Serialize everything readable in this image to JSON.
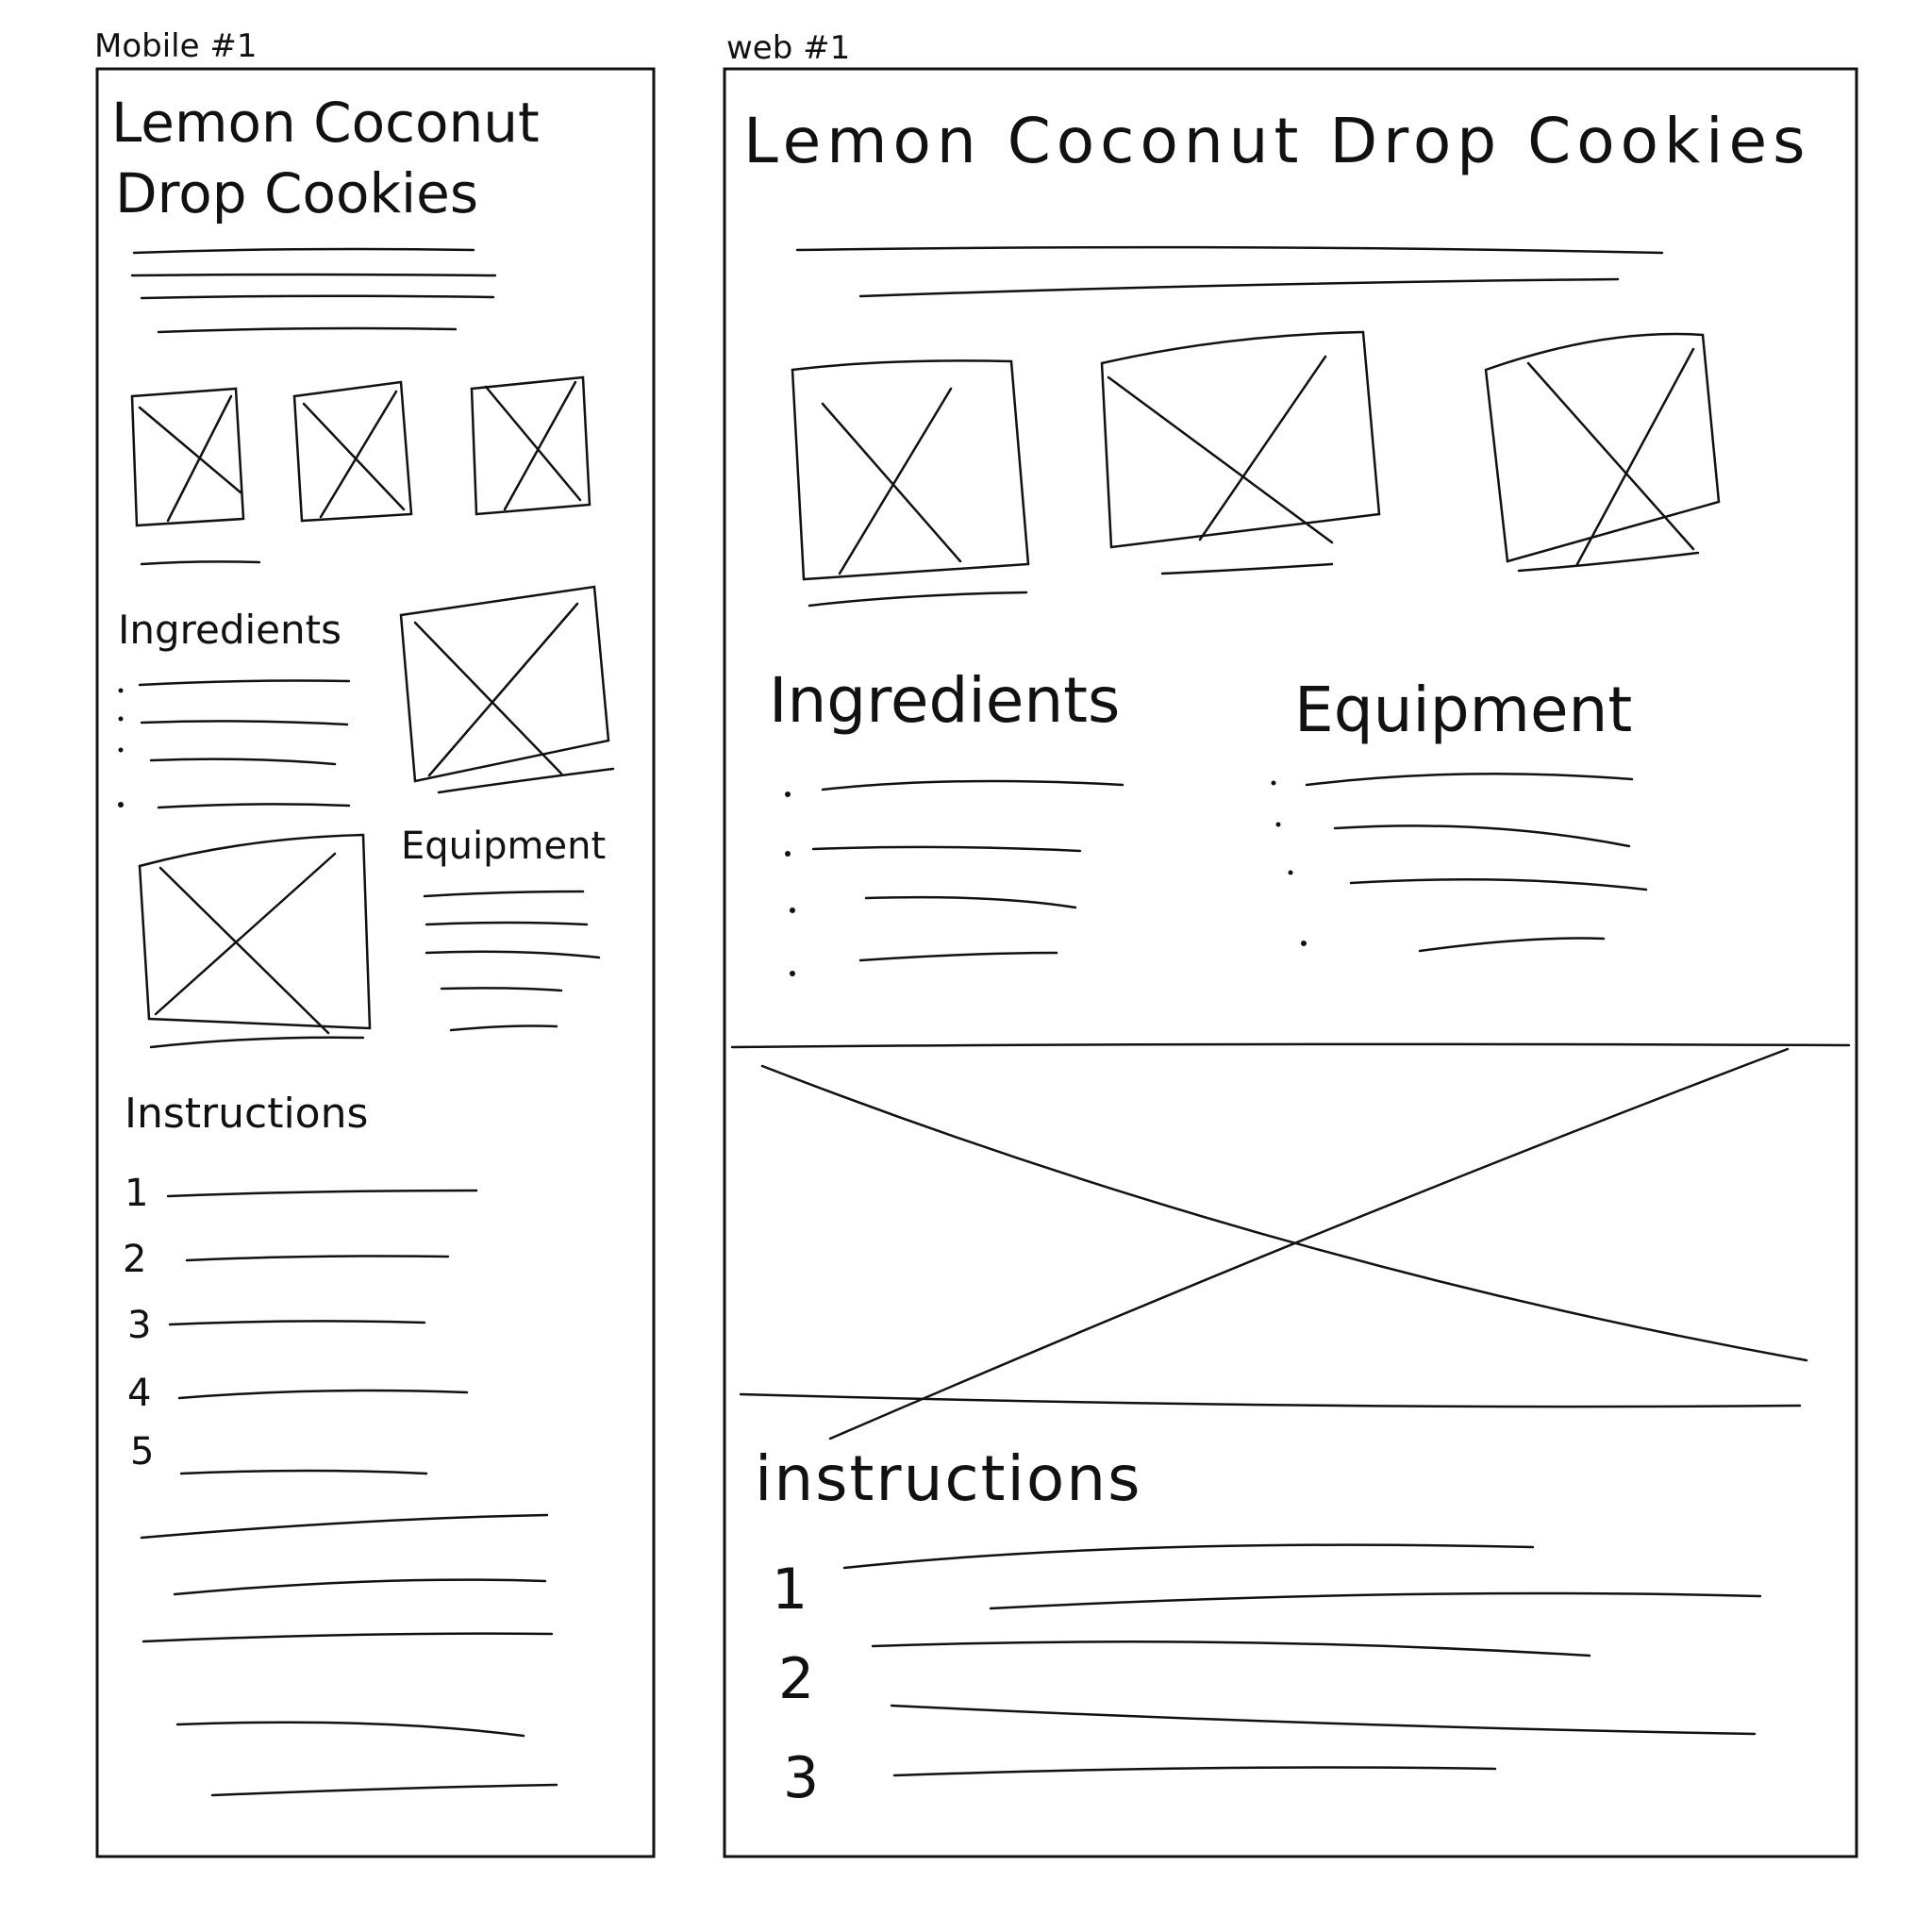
{
  "mobile": {
    "frame_label": "Mobile #1",
    "title_line1": "Lemon Coconut",
    "title_line2": "Drop Cookies",
    "ingredients_heading": "Ingredients",
    "equipment_heading": "Equipment",
    "instructions_heading": "Instructions",
    "step_numbers": [
      "1",
      "2",
      "3",
      "4",
      "5"
    ]
  },
  "web": {
    "frame_label": "web #1",
    "title": "Lemon Coconut Drop Cookies",
    "ingredients_heading": "Ingredients",
    "equipment_heading": "Equipment",
    "instructions_heading": "instructions",
    "step_numbers": [
      "1",
      "2",
      "3"
    ]
  }
}
